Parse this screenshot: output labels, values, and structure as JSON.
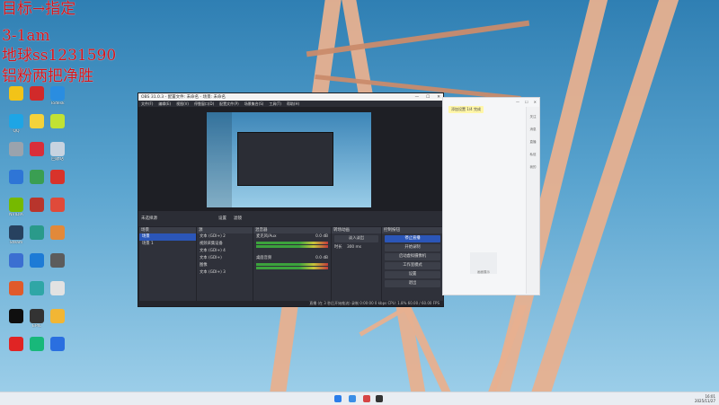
{
  "overlay": {
    "line1": "目标→指定",
    "line2": "3-1am",
    "line3": "地球ss1231590",
    "line4": "铝粉两把净胜"
  },
  "desktop_icons": [
    {
      "label": "",
      "color": "#f2c318"
    },
    {
      "label": "",
      "color": "#d12a2a"
    },
    {
      "label": "Todesk",
      "color": "#2a8de0"
    },
    {
      "label": "QQ",
      "color": "#1ea5e5"
    },
    {
      "label": "",
      "color": "#f4d23a"
    },
    {
      "label": "",
      "color": "#c1e233"
    },
    {
      "label": "",
      "color": "#9aa3ad"
    },
    {
      "label": "",
      "color": "#d92f3a"
    },
    {
      "label": "回收站",
      "color": "#c7d3e0"
    },
    {
      "label": "",
      "color": "#2e75d6"
    },
    {
      "label": "",
      "color": "#3a9e52"
    },
    {
      "label": "",
      "color": "#d8332b"
    },
    {
      "label": "NVIDIA",
      "color": "#76b900"
    },
    {
      "label": "",
      "color": "#b8352c"
    },
    {
      "label": "",
      "color": "#e04a3a"
    },
    {
      "label": "Steam",
      "color": "#27415f"
    },
    {
      "label": "",
      "color": "#2a9a8a"
    },
    {
      "label": "",
      "color": "#e2893a"
    },
    {
      "label": "",
      "color": "#3b6fd1"
    },
    {
      "label": "",
      "color": "#1d7bd6"
    },
    {
      "label": "",
      "color": "#5c5c5c"
    },
    {
      "label": "",
      "color": "#e05a2b"
    },
    {
      "label": "",
      "color": "#2fa6a6"
    },
    {
      "label": "",
      "color": "#e2e2e2"
    },
    {
      "label": "",
      "color": "#0f0f0f"
    },
    {
      "label": "EPIC",
      "color": "#333333"
    },
    {
      "label": "",
      "color": "#f2b634"
    },
    {
      "label": "",
      "color": "#e02424"
    },
    {
      "label": "",
      "color": "#18b87a"
    },
    {
      "label": "",
      "color": "#2a6fe0"
    }
  ],
  "obs": {
    "title": "OBS 31.0.3 - 配置文件: 未命名 - 场景: 未命名",
    "menu": [
      "文件(F)",
      "编辑(E)",
      "视图(V)",
      "停靠窗口(D)",
      "配置文件(P)",
      "场景集合(S)",
      "工具(T)",
      "帮助(H)"
    ],
    "scenebar": {
      "label": "未选择源",
      "settings": "设置",
      "filters": "滤镜"
    },
    "docks": {
      "scenes": {
        "title": "场景",
        "items": [
          "场景",
          "场景 1"
        ]
      },
      "sources": {
        "title": "源",
        "items": [
          "文本 (GDI+) 2",
          "视频采集设备",
          "文本 (GDI+) 4",
          "文本 (GDI+)",
          "图像",
          "文本 (GDI+) 3"
        ]
      },
      "mixer": {
        "title": "混音器",
        "ch1": "麦克风/Aux",
        "ch2": "桌面音频",
        "db": "0.0 dB"
      },
      "transitions": {
        "title": "转场动画",
        "value": "淡入淡出",
        "duration_label": "时长",
        "duration": "300 ms"
      },
      "controls": {
        "title": "控制按钮",
        "buttons": [
          "停止直播",
          "开始录制",
          "启动虚拟摄像机",
          "工作室模式",
          "设置",
          "退出"
        ]
      }
    },
    "status": "直播 (在 3 秒后开始推流)   录制 0:00:00   0 kbps   CPU: 1.8%   60.00 / 60.00 FPS"
  },
  "window2": {
    "tip": "添加设置 1/4 完成",
    "side_items": [
      "关注",
      "消息",
      "直播",
      "私信",
      "我的"
    ],
    "bottom_label": "画面展示"
  },
  "taskbar": {
    "time": "16:01",
    "date": "2025/11/27"
  }
}
